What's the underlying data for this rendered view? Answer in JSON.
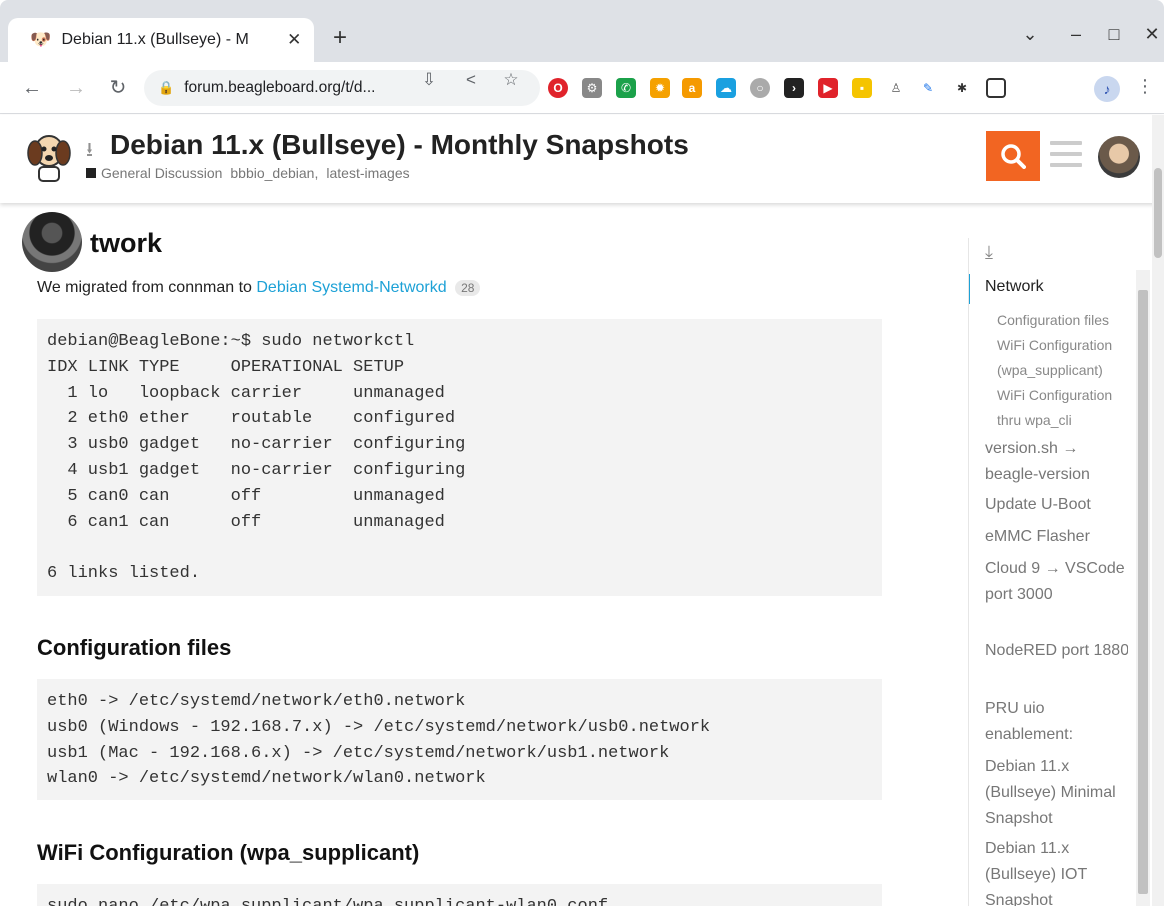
{
  "browser": {
    "tab_title": "Debian 11.x (Bullseye) - M",
    "url": "forum.beagleboard.org/t/d...",
    "new_tab": "+",
    "close": "✕"
  },
  "header": {
    "title": "Debian 11.x (Bullseye) - Monthly Snapshots",
    "category": "General Discussion",
    "tags": [
      "bbbio_debian,",
      "latest-images"
    ]
  },
  "post": {
    "heading": "twork",
    "intro_text": "We migrated from connman to",
    "intro_link": "Debian Systemd-Networkd",
    "link_count": "28",
    "code1": "debian@BeagleBone:~$ sudo networkctl\nIDX LINK TYPE     OPERATIONAL SETUP\n  1 lo   loopback carrier     unmanaged\n  2 eth0 ether    routable    configured\n  3 usb0 gadget   no-carrier  configuring\n  4 usb1 gadget   no-carrier  configuring\n  5 can0 can      off         unmanaged\n  6 can1 can      off         unmanaged\n\n6 links listed.",
    "h_config": "Configuration files",
    "code2": "eth0 -> /etc/systemd/network/eth0.network\nusb0 (Windows - 192.168.7.x) -> /etc/systemd/network/usb0.network\nusb1 (Mac - 192.168.6.x) -> /etc/systemd/network/usb1.network\nwlan0 -> /etc/systemd/network/wlan0.network",
    "h_wifi": "WiFi Configuration (wpa_supplicant)",
    "code3": "sudo nano /etc/wpa_supplicant/wpa_supplicant-wlan0.conf"
  },
  "toc": {
    "items": [
      {
        "label": "Network",
        "sub": false,
        "active": true
      },
      {
        "label": "Configuration files",
        "sub": true
      },
      {
        "label": "WiFi Configuration (wpa_supplicant)",
        "sub": true
      },
      {
        "label": "WiFi Configuration thru wpa_cli",
        "sub": true
      },
      {
        "label": "version.sh → beagle-version",
        "sub": false
      },
      {
        "label": "Update U-Boot",
        "sub": false
      },
      {
        "label": "eMMC Flasher",
        "sub": false
      },
      {
        "label": "Cloud 9 → VSCode port 3000",
        "sub": false
      },
      {
        "label": "NodeRED port 1880",
        "sub": false
      },
      {
        "label": "PRU uio enablement:",
        "sub": false
      },
      {
        "label": "Debian 11.x (Bullseye) Minimal Snapshot",
        "sub": false
      },
      {
        "label": "Debian 11.x (Bullseye) IOT Snapshot",
        "sub": false
      }
    ]
  },
  "colors": {
    "accent": "#f26522",
    "link": "#1da1d6"
  }
}
